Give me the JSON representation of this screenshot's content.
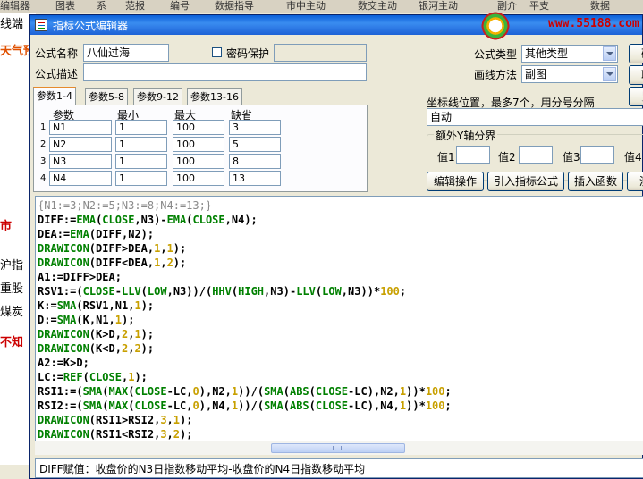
{
  "background": {
    "menu": [
      "编辑器",
      "图表",
      "系",
      "范报",
      "编号",
      "数据指导",
      "市中主动",
      "数交主动",
      "银河主动",
      "副介",
      "平支",
      "数据"
    ],
    "left_items": [
      "线端",
      "天气预",
      "市",
      "沪指",
      "重股",
      "煤炭",
      "不知"
    ]
  },
  "dialog": {
    "title": "指标公式编辑器",
    "watermark_url": "www.55188.com",
    "formula_name_label": "公式名称",
    "formula_name_value": "八仙过海",
    "password_label": "密码保护",
    "password_checked": false,
    "formula_desc_label": "公式描述",
    "formula_desc_value": "",
    "formula_type_label": "公式类型",
    "formula_type_value": "其他类型",
    "draw_method_label": "画线方法",
    "draw_method_value": "副图",
    "side_buttons": [
      "确",
      "取",
      "另"
    ],
    "tabs": [
      "参数1-4",
      "参数5-8",
      "参数9-12",
      "参数13-16"
    ],
    "active_tab": 0,
    "param_headers": [
      "参数",
      "最小",
      "最大",
      "缺省"
    ],
    "params": [
      {
        "num": "1",
        "name": "N1",
        "min": "1",
        "max": "100",
        "default": "3"
      },
      {
        "num": "2",
        "name": "N2",
        "min": "1",
        "max": "100",
        "default": "5"
      },
      {
        "num": "3",
        "name": "N3",
        "min": "1",
        "max": "100",
        "default": "8"
      },
      {
        "num": "4",
        "name": "N4",
        "min": "1",
        "max": "100",
        "default": "13"
      }
    ],
    "coord_label": "坐标线位置，最多7个，用分号分隔",
    "coord_value": "自动",
    "y_axis_title": "额外Y轴分界",
    "y_axis_labels": [
      "值1",
      "值2",
      "值3",
      "值4"
    ],
    "action_buttons": [
      "编辑操作",
      "引入指标公式",
      "插入函数",
      "测"
    ],
    "status_text": "DIFF赋值：收盘价的N3日指数移动平均-收盘价的N4日指数移动平均"
  },
  "code_lines": [
    "{N1:=3;N2:=5;N3:=8;N4:=13;}",
    "DIFF:=EMA(CLOSE,N3)-EMA(CLOSE,N4);",
    "DEA:=EMA(DIFF,N2);",
    "DRAWICON(DIFF>DEA,1,1);",
    "DRAWICON(DIFF<DEA,1,2);",
    "A1:=DIFF>DEA;",
    "RSV1:=(CLOSE-LLV(LOW,N3))/(HHV(HIGH,N3)-LLV(LOW,N3))*100;",
    "K:=SMA(RSV1,N1,1);",
    "D:=SMA(K,N1,1);",
    "DRAWICON(K>D,2,1);",
    "DRAWICON(K<D,2,2);",
    "A2:=K>D;",
    "LC:=REF(CLOSE,1);",
    "RSI1:=(SMA(MAX(CLOSE-LC,0),N2,1))/(SMA(ABS(CLOSE-LC),N2,1))*100;",
    "RSI2:=(SMA(MAX(CLOSE-LC,0),N4,1))/(SMA(ABS(CLOSE-LC),N4,1))*100;",
    "DRAWICON(RSI1>RSI2,3,1);",
    "DRAWICON(RSI1<RSI2,3,2);"
  ],
  "colors": {
    "function": "#008000",
    "number": "#c8a000",
    "comment": "#8a8a8a",
    "title_bar": "#0a5fd8",
    "accent_text": "#c00000"
  }
}
